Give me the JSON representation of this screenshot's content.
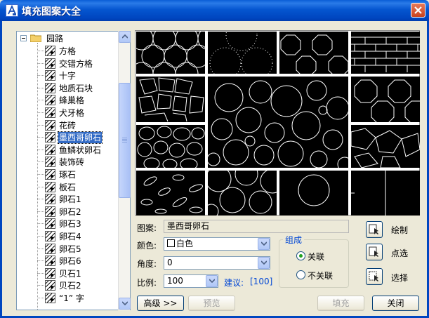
{
  "window": {
    "title": "填充图案大全"
  },
  "tree": {
    "root_label": "园路",
    "items": [
      {
        "label": "方格"
      },
      {
        "label": "交错方格"
      },
      {
        "label": "十字"
      },
      {
        "label": "地质石块"
      },
      {
        "label": "蜂巢格"
      },
      {
        "label": "犬牙格"
      },
      {
        "label": "花砖"
      },
      {
        "label": "墨西哥卵石",
        "selected": true
      },
      {
        "label": "鱼鳞状卵石"
      },
      {
        "label": "装饰砖"
      },
      {
        "label": "琢石"
      },
      {
        "label": "板石"
      },
      {
        "label": "卵石1"
      },
      {
        "label": "卵石2"
      },
      {
        "label": "卵石3"
      },
      {
        "label": "卵石4"
      },
      {
        "label": "卵石5"
      },
      {
        "label": "卵石6"
      },
      {
        "label": "贝石1"
      },
      {
        "label": "贝石2"
      },
      {
        "label": "“1” 字"
      }
    ]
  },
  "form": {
    "pattern_label": "图案:",
    "pattern_value": "墨西哥卵石",
    "color_label": "颜色:",
    "color_value": "白色",
    "angle_label": "角度:",
    "angle_value": "0",
    "scale_label": "比例:",
    "scale_value": "100",
    "suggest_label": "建议:",
    "suggest_value": "[100]"
  },
  "group": {
    "title": "组成",
    "options": [
      {
        "label": "关联",
        "checked": true
      },
      {
        "label": "不关联",
        "checked": false
      }
    ]
  },
  "actions": {
    "draw_label": "绘制",
    "pick_points_label": "点选",
    "select_label": "选择"
  },
  "buttons": {
    "advanced_label": "高级 >>",
    "preview_label": "预览",
    "fill_label": "填充",
    "close_label": "关闭"
  }
}
